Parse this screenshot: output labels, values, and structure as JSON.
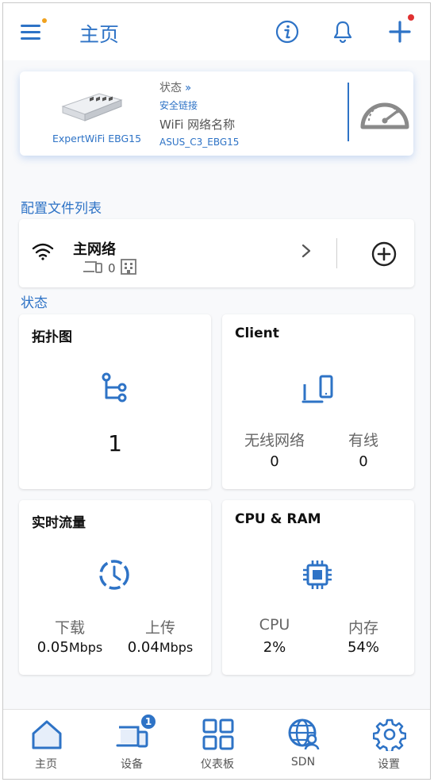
{
  "header": {
    "title": "主页"
  },
  "device": {
    "model": "ExpertWiFi EBG15",
    "status_label": "状态",
    "status_value": "安全链接",
    "wifi_label": "WiFi 网络名称",
    "wifi_value": "ASUS_C3_EBG15"
  },
  "profiles": {
    "section_title": "配置文件列表",
    "items": [
      {
        "name": "主网络",
        "count": "0"
      }
    ]
  },
  "status": {
    "section_title": "状态",
    "topology": {
      "title": "拓扑图",
      "count": "1"
    },
    "client": {
      "title": "Client",
      "wireless_label": "无线网络",
      "wireless_count": "0",
      "wired_label": "有线",
      "wired_count": "0"
    },
    "traffic": {
      "title": "实时流量",
      "down_label": "下载",
      "down_value": "0.05",
      "up_label": "上传",
      "up_value": "0.04",
      "unit": "Mbps"
    },
    "cpu_ram": {
      "title": "CPU & RAM",
      "cpu_label": "CPU",
      "cpu_value": "2%",
      "ram_label": "内存",
      "ram_value": "54%"
    }
  },
  "nav": {
    "items": [
      {
        "label": "主页",
        "icon": "home-icon"
      },
      {
        "label": "设备",
        "icon": "devices-icon",
        "badge": "1"
      },
      {
        "label": "仪表板",
        "icon": "dashboard-icon"
      },
      {
        "label": "SDN",
        "icon": "sdn-globe-icon"
      },
      {
        "label": "设置",
        "icon": "gear-icon"
      }
    ]
  },
  "colors": {
    "accent": "#2e73c6",
    "notification": "#e03131",
    "menu_dot": "#f0a21f"
  }
}
